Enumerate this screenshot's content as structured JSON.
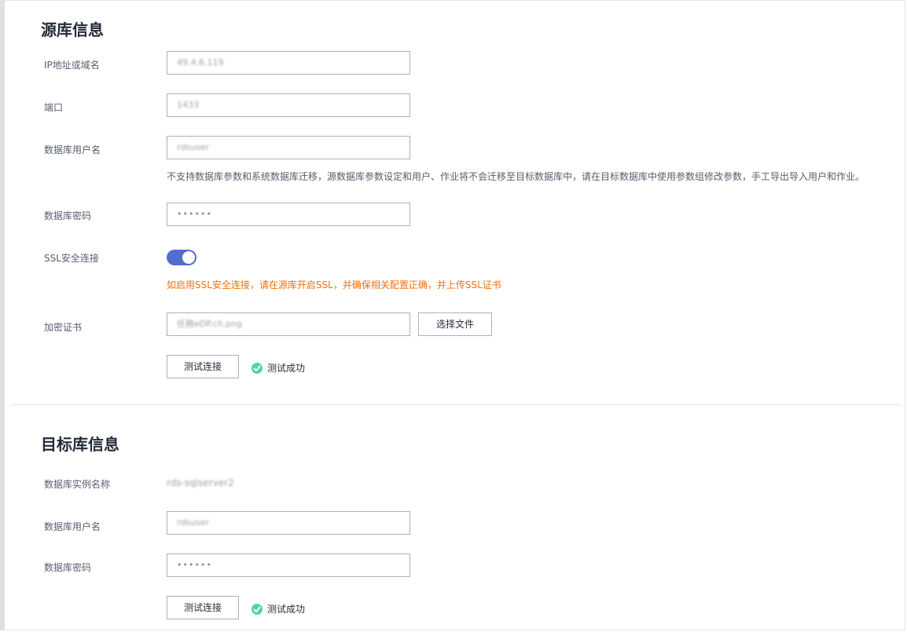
{
  "source": {
    "title": "源库信息",
    "ip_label": "IP地址或域名",
    "ip_value": "49.4.6.119",
    "port_label": "端口",
    "port_value": "1433",
    "user_label": "数据库用户名",
    "user_value": "rdsuser",
    "user_hint": "不支持数据库参数和系统数据库迁移，源数据库参数设定和用户、作业将不会迁移至目标数据库中，请在目标数据库中使用参数组修改参数，手工导出导入用户和作业。",
    "password_label": "数据库密码",
    "password_value": "••••••",
    "ssl_label": "SSL安全连接",
    "ssl_enabled": true,
    "ssl_warning": "如启用SSL安全连接，请在源库开启SSL，并确保相关配置正确，并上传SSL证书",
    "cert_label": "加密证书",
    "cert_value": "任務eDP.ch.png",
    "choose_file_button": "选择文件",
    "test_button": "测试连接",
    "test_status": "测试成功"
  },
  "target": {
    "title": "目标库信息",
    "instance_label": "数据库实例名称",
    "instance_value": "rds-sqlserver2",
    "user_label": "数据库用户名",
    "user_value": "rdsuser",
    "password_label": "数据库密码",
    "password_value": "••••••",
    "test_button": "测试连接",
    "test_status": "测试成功"
  },
  "colors": {
    "toggle_on": "#526ecc",
    "warning": "#f66f0a",
    "success": "#50d4ab"
  }
}
